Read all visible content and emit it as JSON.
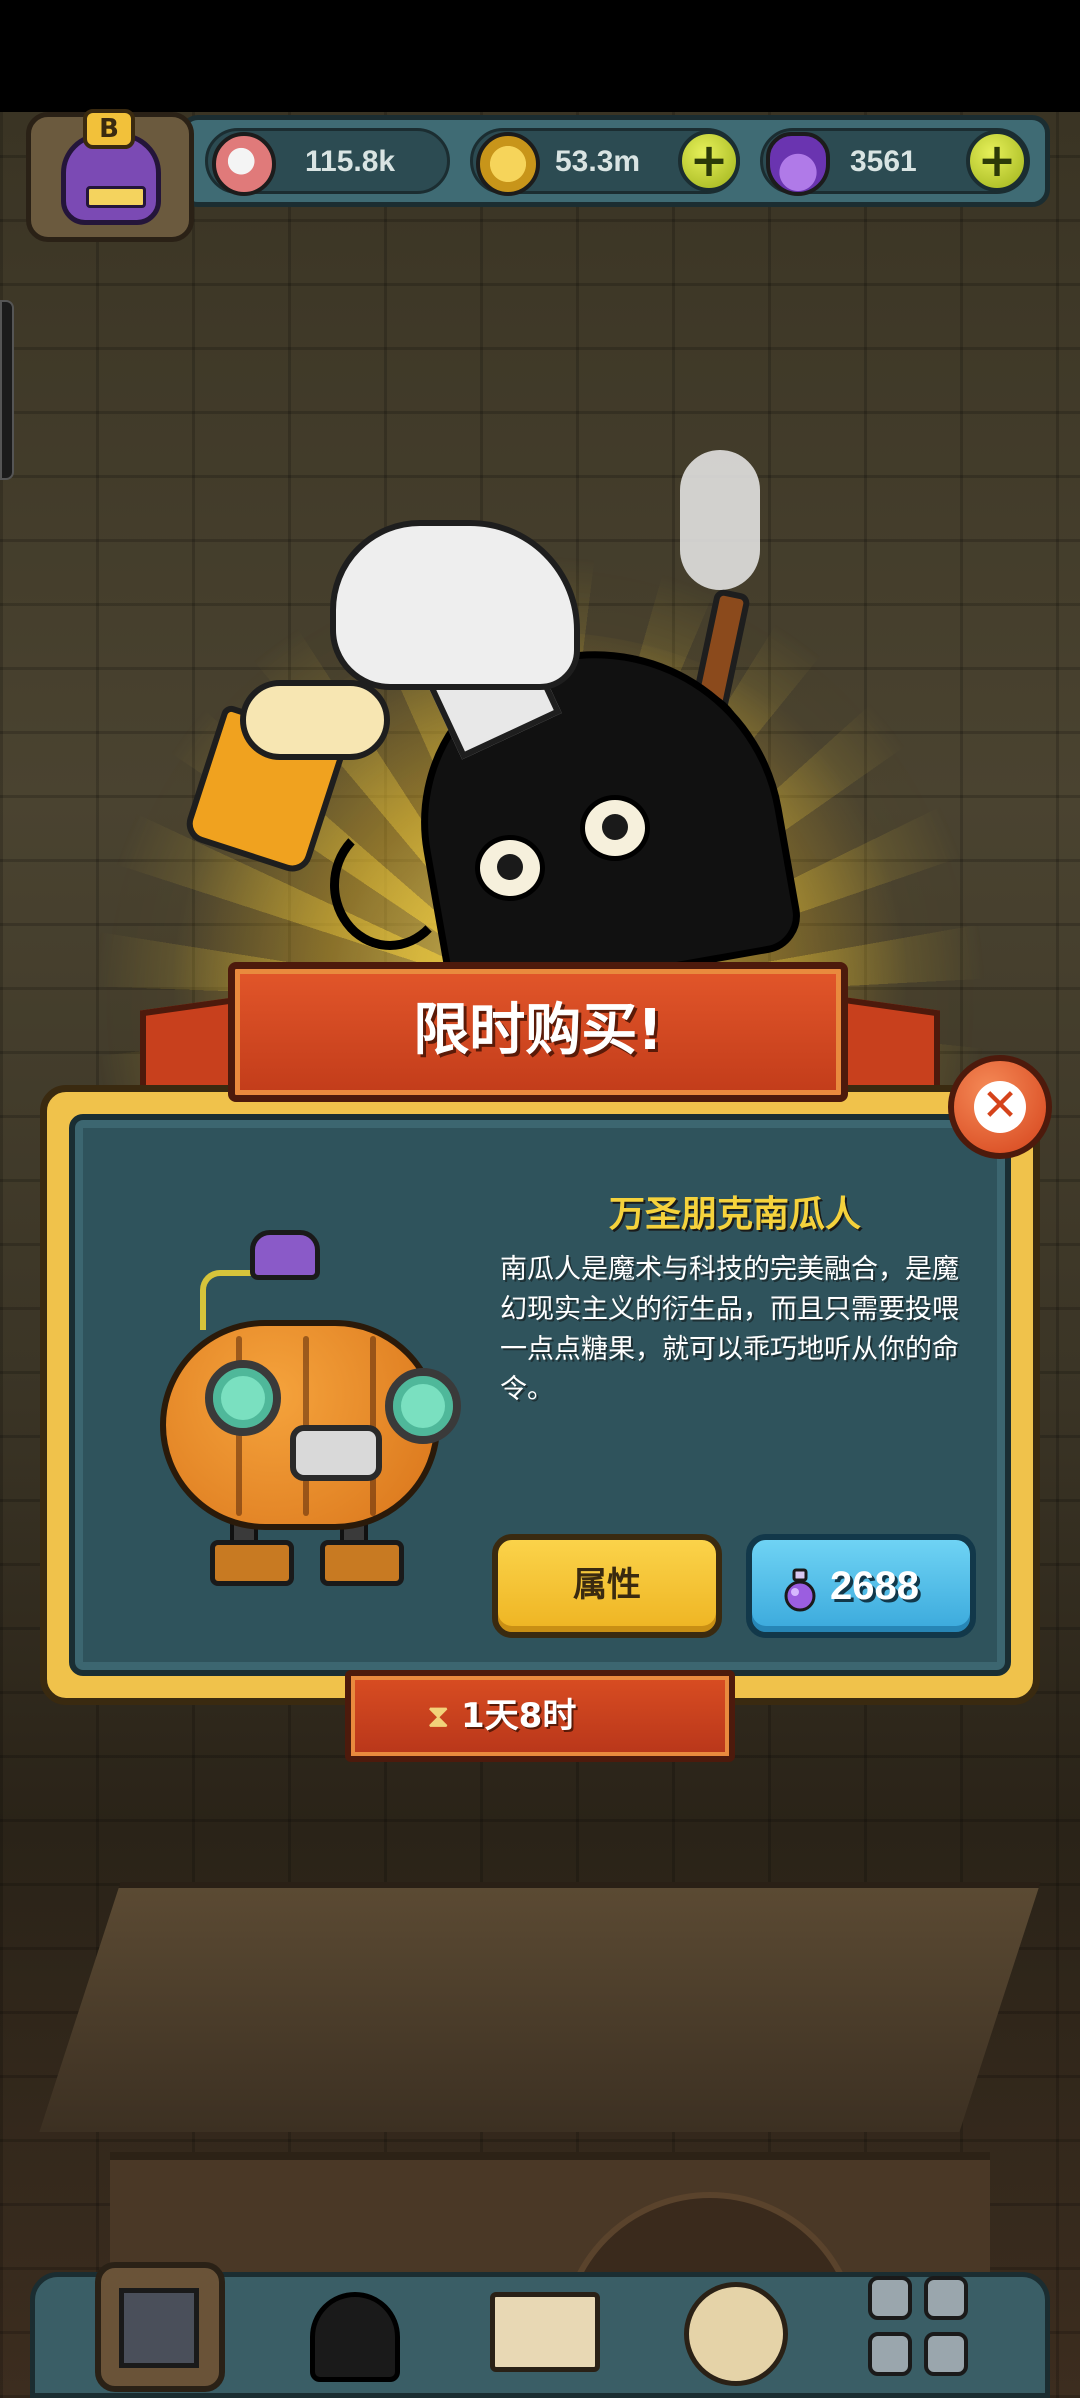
{
  "hud": {
    "rank_badge": "B",
    "resources": [
      {
        "icon": "eyeball-icon",
        "value": "115.8k",
        "color": "#e07a7a"
      },
      {
        "icon": "gold-coin-icon",
        "value": "53.3m",
        "color": "#e2b42a"
      },
      {
        "icon": "potion-icon",
        "value": "3561",
        "color": "#8a4fd0"
      }
    ],
    "plus_label": "+"
  },
  "offer": {
    "banner_title": "限时购买!",
    "close_label": "✕",
    "item_name": "万圣朋克南瓜人",
    "item_description": "南瓜人是魔术与科技的完美融合，是魔幻现实主义的衍生品，而且只需要投喂一点点糖果，就可以乖巧地听从你的命令。",
    "attributes_button": "属性",
    "price": "2688",
    "timer": "1天8时"
  },
  "colors": {
    "panel_gold": "#f0c24b",
    "panel_teal": "#2f535c",
    "banner_red": "#d94d22",
    "title_yellow": "#f5d23c",
    "buy_blue": "#3aa9dc"
  }
}
